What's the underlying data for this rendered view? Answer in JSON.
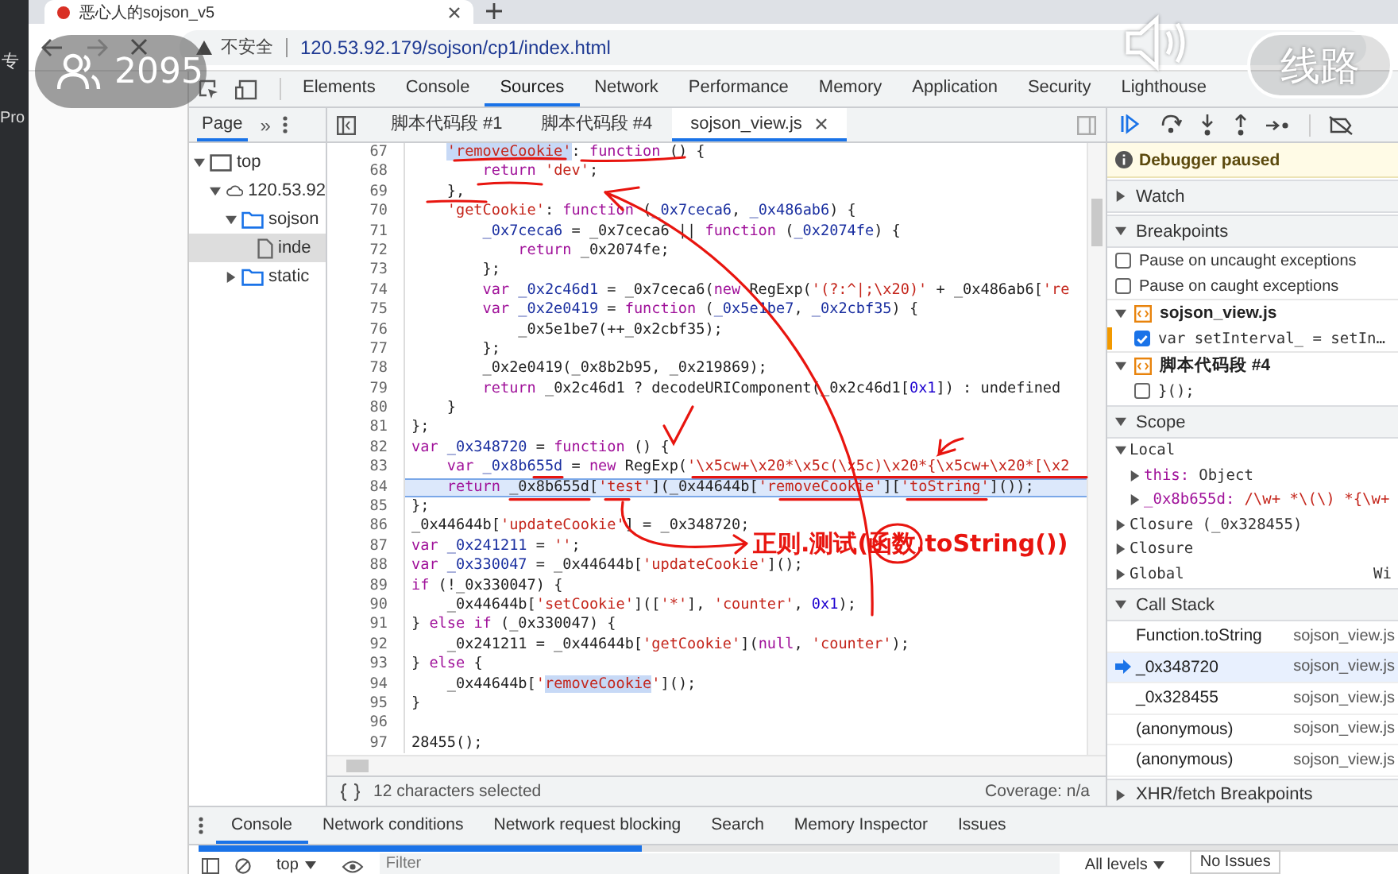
{
  "desktop_edge": [
    "专",
    "Pro"
  ],
  "browser": {
    "tab_title": "恶心人的sojson_v5",
    "security": "不安全",
    "url": "120.53.92.179/sojson/cp1/index.html"
  },
  "overlay": {
    "viewers": "2095",
    "route_button": "线路",
    "video_progress": {
      "level": 0.37
    }
  },
  "devtools_tabs": [
    {
      "label": "Elements",
      "selected": false
    },
    {
      "label": "Console",
      "selected": false
    },
    {
      "label": "Sources",
      "selected": true
    },
    {
      "label": "Network",
      "selected": false
    },
    {
      "label": "Performance",
      "selected": false
    },
    {
      "label": "Memory",
      "selected": false
    },
    {
      "label": "Application",
      "selected": false
    },
    {
      "label": "Security",
      "selected": false
    },
    {
      "label": "Lighthouse",
      "selected": false
    }
  ],
  "navigator": {
    "tab": "Page",
    "more": "»",
    "tree": [
      {
        "label": "top",
        "kind": "frame",
        "expanded": true,
        "selected": false,
        "children": [
          {
            "label": "120.53.92",
            "kind": "host",
            "expanded": true,
            "selected": false,
            "children": [
              {
                "label": "sojson",
                "kind": "folder",
                "expanded": true,
                "selected": false,
                "children": [
                  {
                    "label": "inde",
                    "kind": "file",
                    "selected": true
                  }
                ]
              },
              {
                "label": "static",
                "kind": "folder",
                "expanded": false,
                "selected": false
              }
            ]
          }
        ]
      }
    ]
  },
  "file_tabs": [
    {
      "label": "脚本代码段 #1",
      "selected": false
    },
    {
      "label": "脚本代码段 #4",
      "selected": false
    },
    {
      "label": "sojson_view.js",
      "selected": true
    }
  ],
  "code_lines": [
    {
      "number": "67",
      "paused": false,
      "tokens": [
        {
          "kind": "sel",
          "text": "    'removeCookie'"
        },
        {
          "kind": "plain",
          "text": ": "
        },
        {
          "kind": "kw",
          "text": "function"
        },
        {
          "kind": "plain",
          "text": " () {"
        }
      ]
    },
    {
      "number": "68",
      "paused": false,
      "tokens": [
        {
          "kind": "kw",
          "text": "        return "
        },
        {
          "kind": "str",
          "text": "'dev'"
        },
        {
          "kind": "plain",
          "text": ";"
        }
      ]
    },
    {
      "number": "69",
      "paused": false,
      "tokens": [
        {
          "kind": "plain",
          "text": "    },"
        }
      ]
    },
    {
      "number": "70",
      "paused": false,
      "tokens": [
        {
          "kind": "str",
          "text": "    'getCookie'"
        },
        {
          "kind": "plain",
          "text": ": "
        },
        {
          "kind": "kw",
          "text": "function"
        },
        {
          "kind": "plain",
          "text": " ("
        },
        {
          "kind": "var",
          "text": "_0x7ceca6"
        },
        {
          "kind": "plain",
          "text": ", "
        },
        {
          "kind": "var",
          "text": "_0x486ab6"
        },
        {
          "kind": "plain",
          "text": ") {"
        }
      ]
    },
    {
      "number": "71",
      "paused": false,
      "tokens": [
        {
          "kind": "var",
          "text": "        _0x7ceca6"
        },
        {
          "kind": "plain",
          "text": " = _0x7ceca6 || "
        },
        {
          "kind": "kw",
          "text": "function"
        },
        {
          "kind": "plain",
          "text": " ("
        },
        {
          "kind": "var",
          "text": "_0x2074fe"
        },
        {
          "kind": "plain",
          "text": ") {"
        }
      ]
    },
    {
      "number": "72",
      "paused": false,
      "tokens": [
        {
          "kind": "kw",
          "text": "            return"
        },
        {
          "kind": "plain",
          "text": " _0x2074fe;"
        }
      ]
    },
    {
      "number": "73",
      "paused": false,
      "tokens": [
        {
          "kind": "plain",
          "text": "        };"
        }
      ]
    },
    {
      "number": "74",
      "paused": false,
      "tokens": [
        {
          "kind": "kw",
          "text": "        var "
        },
        {
          "kind": "var",
          "text": "_0x2c46d1"
        },
        {
          "kind": "plain",
          "text": " = _0x7ceca6("
        },
        {
          "kind": "kw",
          "text": "new"
        },
        {
          "kind": "plain",
          "text": " RegExp("
        },
        {
          "kind": "str",
          "text": "'(?:^|;\\x20)'"
        },
        {
          "kind": "plain",
          "text": " + _0x486ab6["
        },
        {
          "kind": "str",
          "text": "'re"
        }
      ]
    },
    {
      "number": "75",
      "paused": false,
      "tokens": [
        {
          "kind": "kw",
          "text": "        var "
        },
        {
          "kind": "var",
          "text": "_0x2e0419"
        },
        {
          "kind": "plain",
          "text": " = "
        },
        {
          "kind": "kw",
          "text": "function"
        },
        {
          "kind": "plain",
          "text": " ("
        },
        {
          "kind": "var",
          "text": "_0x5e1be7"
        },
        {
          "kind": "plain",
          "text": ", "
        },
        {
          "kind": "var",
          "text": "_0x2cbf35"
        },
        {
          "kind": "plain",
          "text": ") {"
        }
      ]
    },
    {
      "number": "76",
      "paused": false,
      "tokens": [
        {
          "kind": "plain",
          "text": "            _0x5e1be7(++_0x2cbf35);"
        }
      ]
    },
    {
      "number": "77",
      "paused": false,
      "tokens": [
        {
          "kind": "plain",
          "text": "        };"
        }
      ]
    },
    {
      "number": "78",
      "paused": false,
      "tokens": [
        {
          "kind": "plain",
          "text": "        _0x2e0419(_0x8b2b95, _0x219869);"
        }
      ]
    },
    {
      "number": "79",
      "paused": false,
      "tokens": [
        {
          "kind": "kw",
          "text": "        return"
        },
        {
          "kind": "plain",
          "text": " _0x2c46d1 ? decodeURIComponent(_0x2c46d1["
        },
        {
          "kind": "num",
          "text": "0x1"
        },
        {
          "kind": "plain",
          "text": "]) : undefined"
        }
      ]
    },
    {
      "number": "80",
      "paused": false,
      "tokens": [
        {
          "kind": "plain",
          "text": "    }"
        }
      ]
    },
    {
      "number": "81",
      "paused": false,
      "tokens": [
        {
          "kind": "plain",
          "text": "};"
        }
      ]
    },
    {
      "number": "82",
      "paused": false,
      "tokens": [
        {
          "kind": "kw",
          "text": "var "
        },
        {
          "kind": "var",
          "text": "_0x348720"
        },
        {
          "kind": "plain",
          "text": " = "
        },
        {
          "kind": "kw",
          "text": "function"
        },
        {
          "kind": "plain",
          "text": " () {"
        }
      ]
    },
    {
      "number": "83",
      "paused": false,
      "tokens": [
        {
          "kind": "kw",
          "text": "    var "
        },
        {
          "kind": "var",
          "text": "_0x8b655d"
        },
        {
          "kind": "plain",
          "text": " = "
        },
        {
          "kind": "kw",
          "text": "new"
        },
        {
          "kind": "plain",
          "text": " RegExp("
        },
        {
          "kind": "str",
          "text": "'\\x5cw+\\x20*\\x5c(\\x5c)\\x20*{\\x5cw+\\x20*[\\x2"
        }
      ]
    },
    {
      "number": "84",
      "paused": true,
      "tokens": [
        {
          "kind": "kw",
          "text": "    return"
        },
        {
          "kind": "plain",
          "text": " _0x8b655d["
        },
        {
          "kind": "str",
          "text": "'test'"
        },
        {
          "kind": "plain",
          "text": "](_0x44644b["
        },
        {
          "kind": "str",
          "text": "'removeCookie'"
        },
        {
          "kind": "plain",
          "text": "]["
        },
        {
          "kind": "str",
          "text": "'toString'"
        },
        {
          "kind": "plain",
          "text": "]());"
        }
      ]
    },
    {
      "number": "85",
      "paused": false,
      "tokens": [
        {
          "kind": "plain",
          "text": "};"
        }
      ]
    },
    {
      "number": "86",
      "paused": false,
      "tokens": [
        {
          "kind": "plain",
          "text": "_0x44644b["
        },
        {
          "kind": "str",
          "text": "'updateCookie'"
        },
        {
          "kind": "plain",
          "text": "] = _0x348720;"
        }
      ]
    },
    {
      "number": "87",
      "paused": false,
      "tokens": [
        {
          "kind": "kw",
          "text": "var "
        },
        {
          "kind": "var",
          "text": "_0x241211"
        },
        {
          "kind": "plain",
          "text": " = "
        },
        {
          "kind": "str",
          "text": "''"
        },
        {
          "kind": "plain",
          "text": ";"
        }
      ]
    },
    {
      "number": "88",
      "paused": false,
      "tokens": [
        {
          "kind": "kw",
          "text": "var "
        },
        {
          "kind": "var",
          "text": "_0x330047"
        },
        {
          "kind": "plain",
          "text": " = _0x44644b["
        },
        {
          "kind": "str",
          "text": "'updateCookie'"
        },
        {
          "kind": "plain",
          "text": "]();"
        }
      ]
    },
    {
      "number": "89",
      "paused": false,
      "tokens": [
        {
          "kind": "kw",
          "text": "if"
        },
        {
          "kind": "plain",
          "text": " (!_0x330047) {"
        }
      ]
    },
    {
      "number": "90",
      "paused": false,
      "tokens": [
        {
          "kind": "plain",
          "text": "    _0x44644b["
        },
        {
          "kind": "str",
          "text": "'setCookie'"
        },
        {
          "kind": "plain",
          "text": "](["
        },
        {
          "kind": "str",
          "text": "'*'"
        },
        {
          "kind": "plain",
          "text": "], "
        },
        {
          "kind": "str",
          "text": "'counter'"
        },
        {
          "kind": "plain",
          "text": ", "
        },
        {
          "kind": "num",
          "text": "0x1"
        },
        {
          "kind": "plain",
          "text": ");"
        }
      ]
    },
    {
      "number": "91",
      "paused": false,
      "tokens": [
        {
          "kind": "plain",
          "text": "} "
        },
        {
          "kind": "kw",
          "text": "else if"
        },
        {
          "kind": "plain",
          "text": " (_0x330047) {"
        }
      ]
    },
    {
      "number": "92",
      "paused": false,
      "tokens": [
        {
          "kind": "plain",
          "text": "    _0x241211 = _0x44644b["
        },
        {
          "kind": "str",
          "text": "'getCookie'"
        },
        {
          "kind": "plain",
          "text": "]("
        },
        {
          "kind": "kw",
          "text": "null"
        },
        {
          "kind": "plain",
          "text": ", "
        },
        {
          "kind": "str",
          "text": "'counter'"
        },
        {
          "kind": "plain",
          "text": ");"
        }
      ]
    },
    {
      "number": "93",
      "paused": false,
      "tokens": [
        {
          "kind": "plain",
          "text": "} "
        },
        {
          "kind": "kw",
          "text": "else"
        },
        {
          "kind": "plain",
          "text": " {"
        }
      ]
    },
    {
      "number": "94",
      "paused": false,
      "tokens": [
        {
          "kind": "plain",
          "text": "    _0x44644b["
        },
        {
          "kind": "str",
          "text": "'"
        },
        {
          "kind": "sel",
          "text": "removeCookie"
        },
        {
          "kind": "str",
          "text": "'"
        },
        {
          "kind": "plain",
          "text": "]();"
        }
      ]
    },
    {
      "number": "95",
      "paused": false,
      "tokens": [
        {
          "kind": "plain",
          "text": "}"
        }
      ]
    },
    {
      "number": "96",
      "paused": false
    },
    {
      "number": "97",
      "paused": false,
      "tokens": [
        {
          "kind": "plain",
          "text": "28455();"
        }
      ]
    }
  ],
  "annotation": {
    "text": "正则.测试(函数.toString())"
  },
  "status_bar": {
    "selection": "12 characters selected",
    "coverage": "Coverage: n/a"
  },
  "debugger": {
    "paused_message": "Debugger paused",
    "watch": {
      "title": "Watch",
      "expanded": false
    },
    "breakpoints": {
      "title": "Breakpoints",
      "expanded": true,
      "options": [
        {
          "label": "Pause on uncaught exceptions",
          "checked": false
        },
        {
          "label": "Pause on caught exceptions",
          "checked": false
        }
      ],
      "files": [
        {
          "name": "sojson_view.js",
          "expanded": true,
          "items": [
            {
              "code": "var setInterval_ = setIn…",
              "checked": true
            }
          ]
        },
        {
          "name": "脚本代码段 #4",
          "expanded": true,
          "items": [
            {
              "code": "}();",
              "checked": false
            }
          ]
        }
      ]
    },
    "scope": {
      "title": "Scope",
      "expanded": true,
      "entries": [
        {
          "label": "Local",
          "expanded": true,
          "children": [
            {
              "name": "this:",
              "value": "Object",
              "kind": "object"
            },
            {
              "name": "_0x8b655d:",
              "value": "/\\w+ *\\(\\) *{\\w+",
              "kind": "regexp"
            }
          ]
        },
        {
          "label": "Closure (_0x328455)",
          "expanded": false
        },
        {
          "label": "Closure",
          "expanded": false
        },
        {
          "label": "Global",
          "expanded": false,
          "value": "Wi"
        }
      ]
    },
    "call_stack": {
      "title": "Call Stack",
      "expanded": true,
      "frames": [
        {
          "name": "Function.toString",
          "location": "sojson_view.js",
          "current": false
        },
        {
          "name": "_0x348720",
          "location": "sojson_view.js",
          "current": true
        },
        {
          "name": "_0x328455",
          "location": "sojson_view.js",
          "current": false
        },
        {
          "name": "(anonymous)",
          "location": "sojson_view.js",
          "current": false
        },
        {
          "name": "(anonymous)",
          "location": "sojson_view.js",
          "current": false
        }
      ]
    },
    "xhr": {
      "title": "XHR/fetch Breakpoints",
      "expanded": false
    }
  },
  "drawer_tabs": [
    {
      "label": "Console",
      "selected": true
    },
    {
      "label": "Network conditions",
      "selected": false
    },
    {
      "label": "Network request blocking",
      "selected": false
    },
    {
      "label": "Search",
      "selected": false
    },
    {
      "label": "Memory Inspector",
      "selected": false
    },
    {
      "label": "Issues",
      "selected": false
    }
  ],
  "console_toolbar": {
    "context": "top",
    "filter_placeholder": "Filter",
    "levels": "All levels",
    "issues": "No Issues"
  }
}
